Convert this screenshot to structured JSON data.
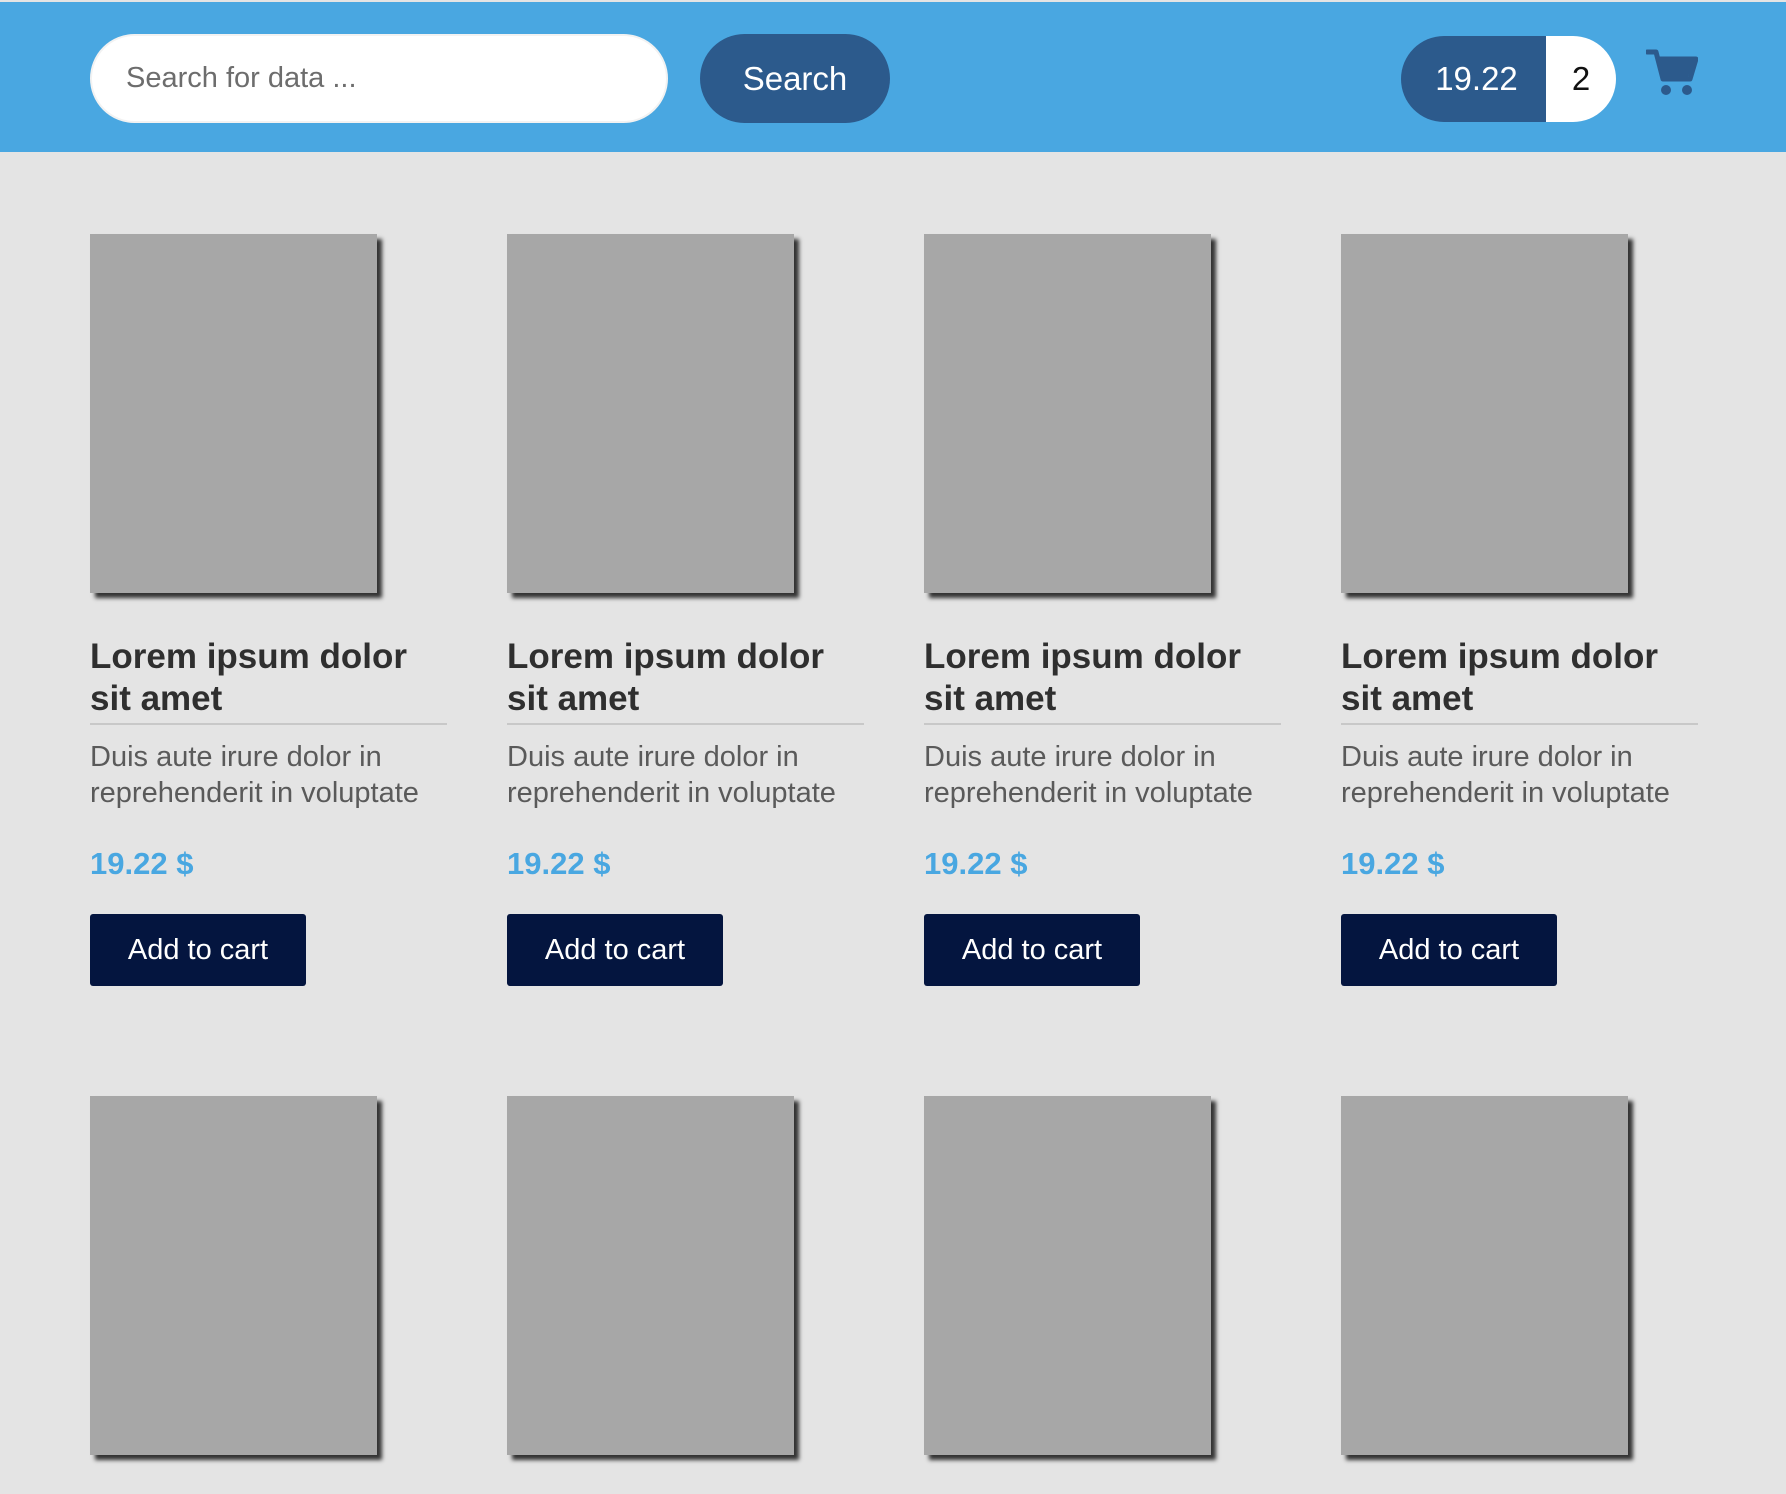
{
  "header": {
    "background": "#49a7e1",
    "search": {
      "placeholder": "Search for data ...",
      "value": "",
      "button_label": "Search"
    },
    "cart": {
      "total": "19.22",
      "count": "2",
      "icon": "shopping-cart-icon",
      "accent": "#2c5a8c"
    }
  },
  "products": [
    {
      "title": "Lorem ipsum dolor sit amet",
      "description": "Duis aute irure dolor in reprehenderit in voluptate",
      "price": "19.22 $",
      "button_label": "Add to cart"
    },
    {
      "title": "Lorem ipsum dolor sit amet",
      "description": "Duis aute irure dolor in reprehenderit in voluptate",
      "price": "19.22 $",
      "button_label": "Add to cart"
    },
    {
      "title": "Lorem ipsum dolor sit amet",
      "description": "Duis aute irure dolor in reprehenderit in voluptate",
      "price": "19.22 $",
      "button_label": "Add to cart"
    },
    {
      "title": "Lorem ipsum dolor sit amet",
      "description": "Duis aute irure dolor in reprehenderit in voluptate",
      "price": "19.22 $",
      "button_label": "Add to cart"
    },
    {
      "title": "",
      "description": "",
      "price": "",
      "button_label": ""
    },
    {
      "title": "",
      "description": "",
      "price": "",
      "button_label": ""
    },
    {
      "title": "",
      "description": "",
      "price": "",
      "button_label": ""
    },
    {
      "title": "",
      "description": "",
      "price": "",
      "button_label": ""
    }
  ],
  "colors": {
    "page_background": "#e4e4e4",
    "image_placeholder": "#a7a7a7",
    "price": "#49a7e1",
    "add_button": "#04153f"
  }
}
